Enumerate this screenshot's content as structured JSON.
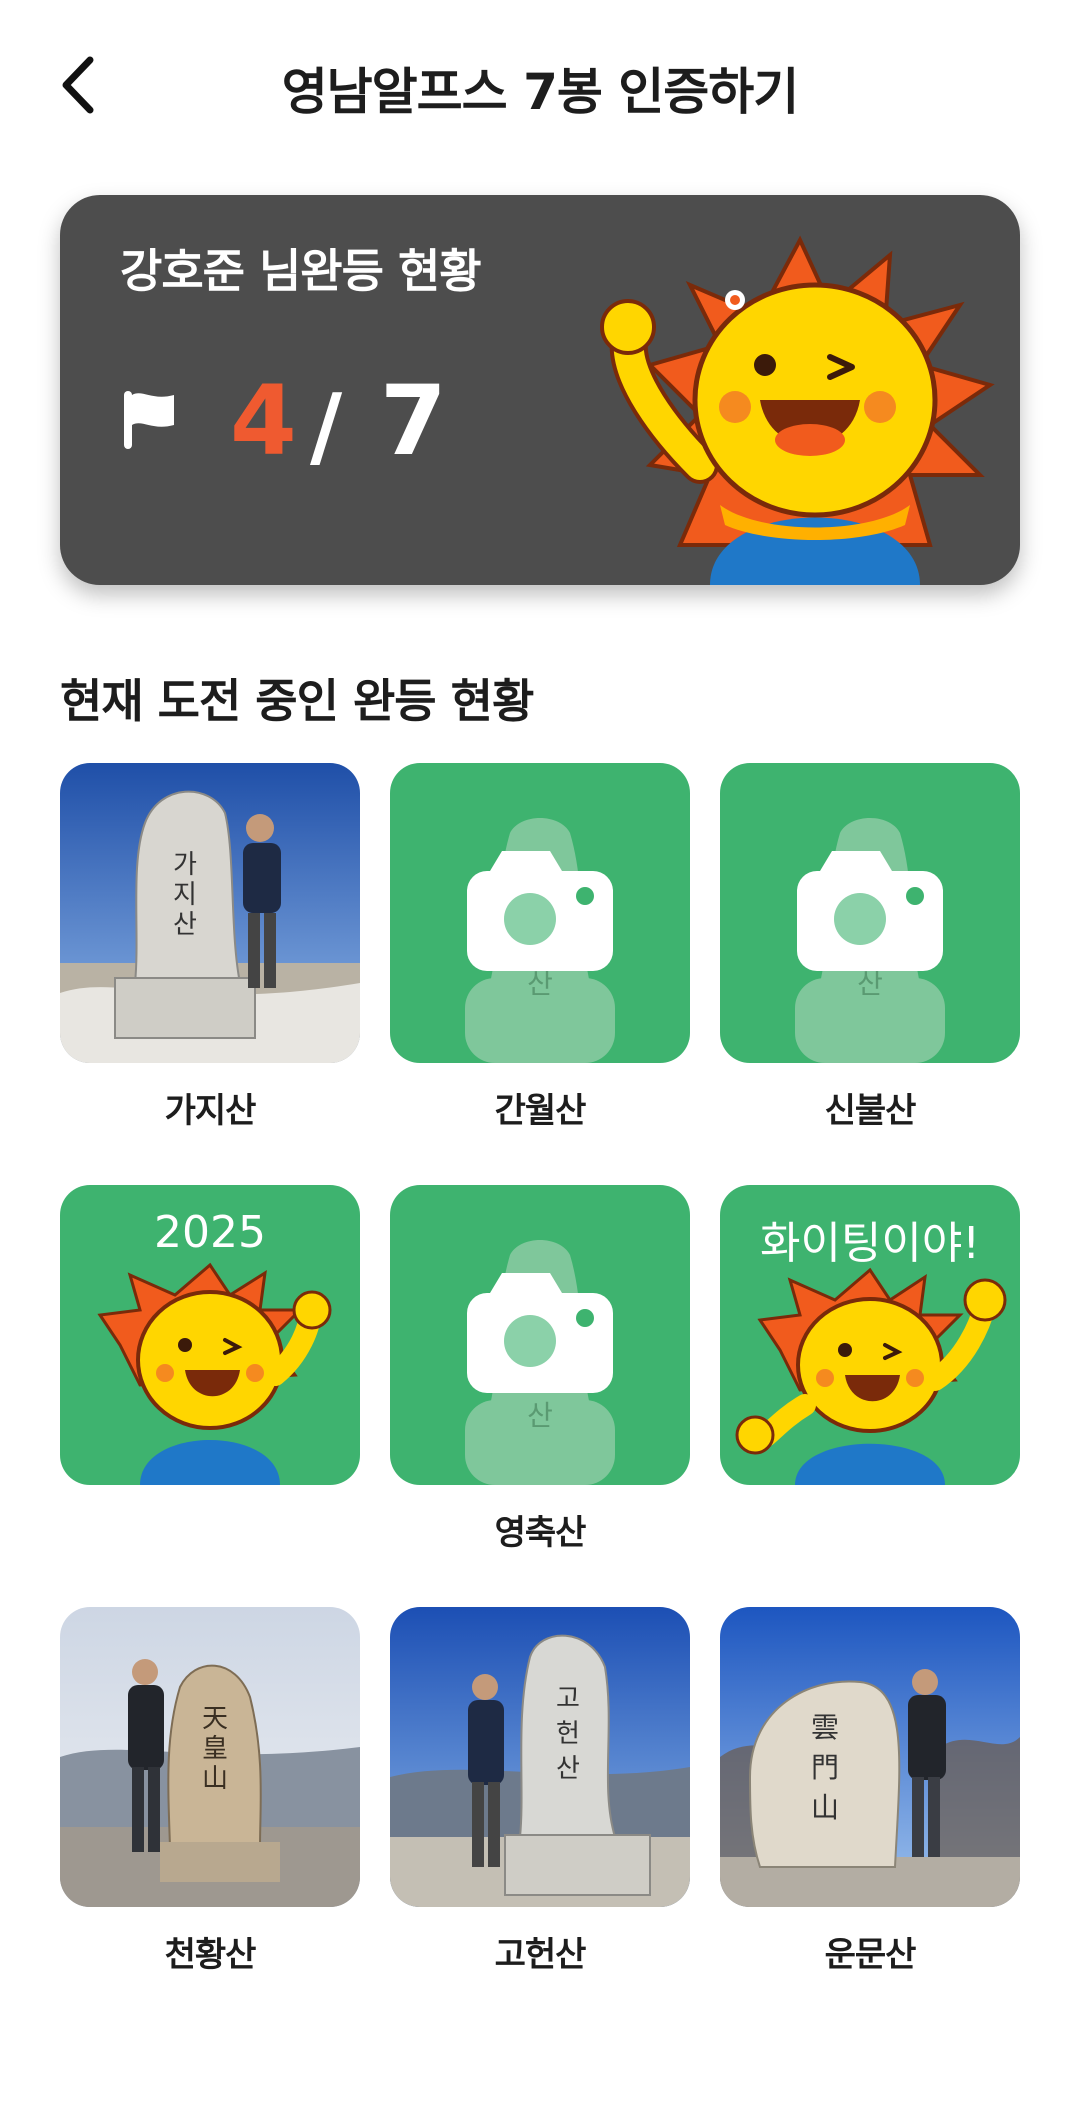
{
  "header": {
    "title": "영남알프스 7봉 인증하기"
  },
  "status": {
    "title": "강호준 님완등 현황",
    "done": "4",
    "slash": "/",
    "total": "7"
  },
  "section": {
    "title": "현재 도전 중인 완등 현황"
  },
  "tiles": [
    {
      "label": "가지산",
      "state": "photo"
    },
    {
      "label": "간월산",
      "state": "camera"
    },
    {
      "label": "신불산",
      "state": "camera"
    },
    {
      "label": "",
      "state": "badge",
      "text": "2025"
    },
    {
      "label": "영축산",
      "state": "camera"
    },
    {
      "label": "",
      "state": "badge",
      "text": "화이팅이야!"
    },
    {
      "label": "천황산",
      "state": "photo"
    },
    {
      "label": "고헌산",
      "state": "photo"
    },
    {
      "label": "운문산",
      "state": "photo"
    }
  ],
  "colors": {
    "accent": "#ef5a30",
    "card_bg": "#4d4d4d",
    "tile_green": "#3eb36f"
  },
  "icons": {
    "back": "chevron-left-icon",
    "flag": "flag-icon",
    "camera": "camera-icon"
  }
}
